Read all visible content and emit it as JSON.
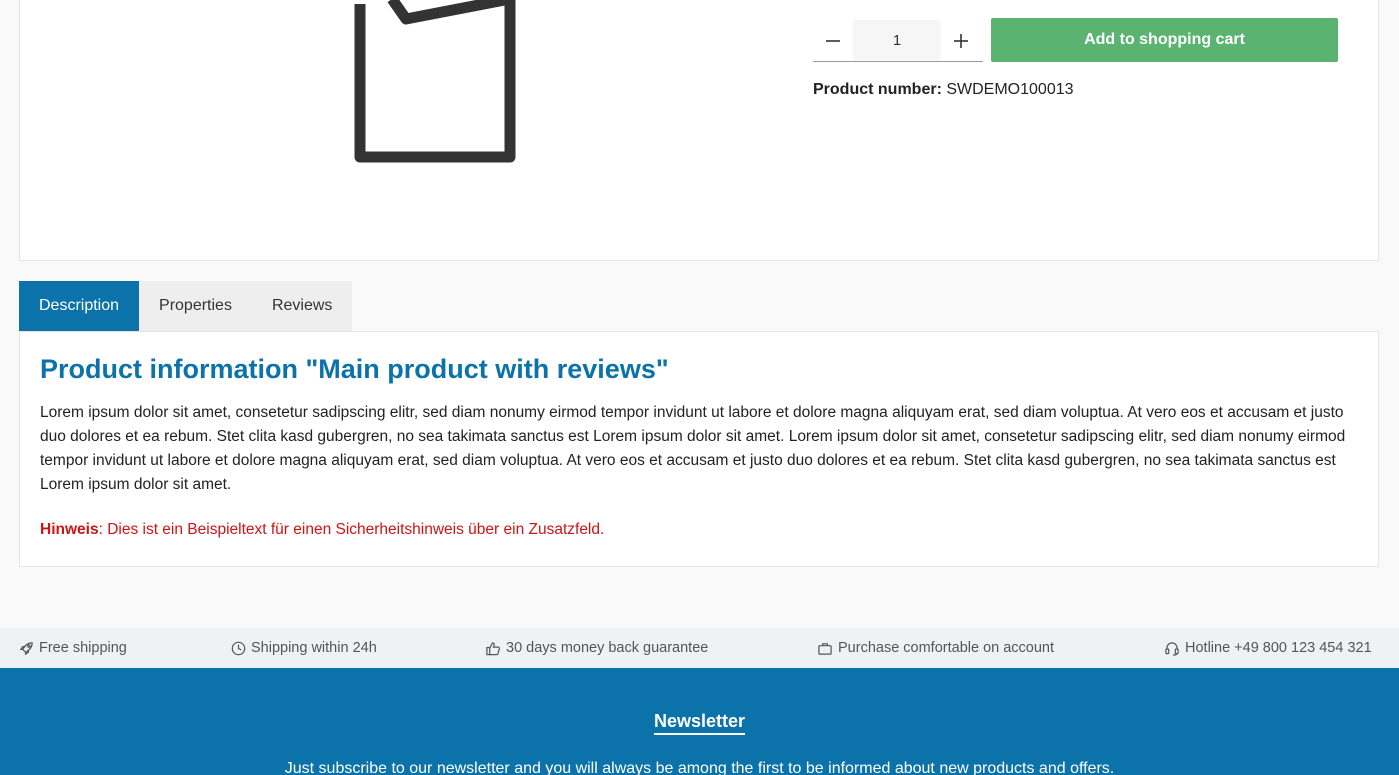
{
  "product": {
    "quantity": "1",
    "add_to_cart_label": "Add to shopping cart",
    "number_label": "Product number:",
    "number_value": "SWDEMO100013"
  },
  "tabs": [
    {
      "label": "Description",
      "active": true
    },
    {
      "label": "Properties",
      "active": false
    },
    {
      "label": "Reviews",
      "active": false
    }
  ],
  "description": {
    "title": "Product information \"Main product with reviews\"",
    "body": "Lorem ipsum dolor sit amet, consetetur sadipscing elitr, sed diam nonumy eirmod tempor invidunt ut labore et dolore magna aliquyam erat, sed diam voluptua. At vero eos et accusam et justo duo dolores et ea rebum. Stet clita kasd gubergren, no sea takimata sanctus est Lorem ipsum dolor sit amet. Lorem ipsum dolor sit amet, consetetur sadipscing elitr, sed diam nonumy eirmod tempor invidunt ut labore et dolore magna aliquyam erat, sed diam voluptua. At vero eos et accusam et justo duo dolores et ea rebum. Stet clita kasd gubergren, no sea takimata sanctus est Lorem ipsum dolor sit amet.",
    "note_label": "Hinweis",
    "note_text": ": Dies ist ein Beispieltext für einen Sicherheitshinweis über ein Zusatzfeld."
  },
  "usps": [
    {
      "icon": "rocket-icon",
      "label": "Free shipping"
    },
    {
      "icon": "clock-icon",
      "label": "Shipping within 24h"
    },
    {
      "icon": "thumbs-up-icon",
      "label": "30 days money back guarantee"
    },
    {
      "icon": "briefcase-icon",
      "label": "Purchase comfortable on account"
    },
    {
      "icon": "headset-icon",
      "label": "Hotline +49 800 123 454 321"
    }
  ],
  "newsletter": {
    "title": "Newsletter",
    "text": "Just subscribe to our newsletter and you will always be among the first to be informed about new products and offers."
  },
  "colors": {
    "primary": "#0b72aa",
    "buy": "#5ab371",
    "note": "#cc1414"
  }
}
